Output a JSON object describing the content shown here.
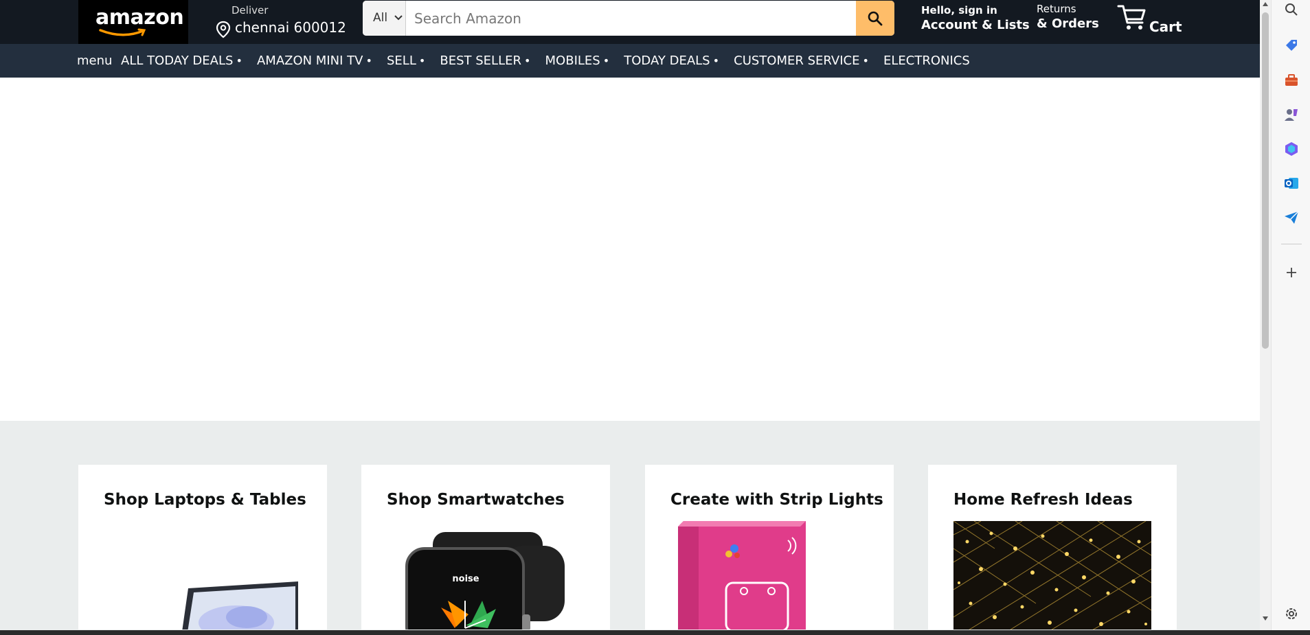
{
  "header": {
    "logo_text": "amazon",
    "deliver_label": "Deliver",
    "deliver_location": "chennai 600012",
    "search_category": "All",
    "search_placeholder": "Search Amazon",
    "account_line1": "Hello, sign in",
    "account_line2": "Account & Lists",
    "orders_line1": "Returns",
    "orders_line2": "& Orders",
    "cart_label": "Cart"
  },
  "subnav": {
    "menu_label": "menu",
    "links": [
      "ALL TODAY DEALS",
      "AMAZON MINI TV",
      "SELL",
      "BEST SELLER",
      "MOBILES",
      "TODAY DEALS",
      "CUSTOMER SERVICE",
      "ELECTRONICS"
    ],
    "separator": "•"
  },
  "cards": [
    {
      "title": "Shop Laptops & Tables"
    },
    {
      "title": "Shop Smartwatches",
      "watch_brand": "noise"
    },
    {
      "title": "Create with Strip Lights"
    },
    {
      "title": "Home Refresh Ideas"
    }
  ],
  "colors": {
    "header_bg": "#131921",
    "subnav_bg": "#232f3e",
    "search_button": "#febd69",
    "page_gray": "#eaeded"
  },
  "sidebar_icons": [
    "search-icon",
    "tag-icon",
    "briefcase-icon",
    "games-icon",
    "copilot-icon",
    "outlook-icon",
    "send-icon",
    "add-icon",
    "settings-icon"
  ]
}
